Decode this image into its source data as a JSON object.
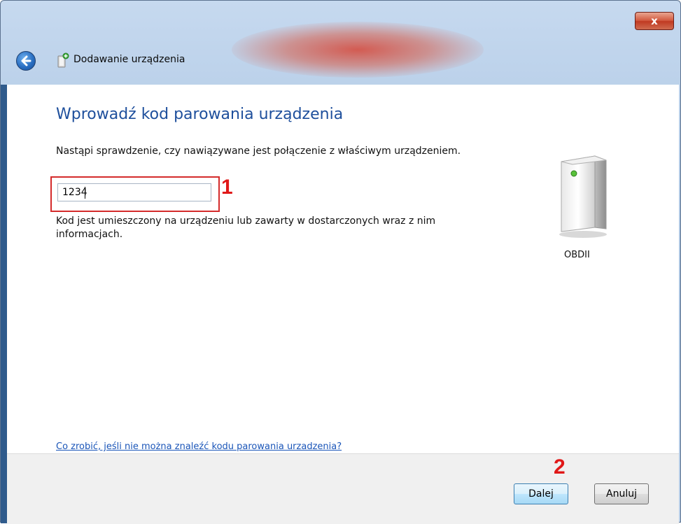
{
  "window": {
    "title": "Dodawanie urządzenia",
    "close_glyph": "x"
  },
  "content": {
    "heading": "Wprowadź kod parowania urządzenia",
    "instruction": "Nastąpi sprawdzenie, czy nawiązywane jest połączenie z właściwym urządzeniem.",
    "code_value": "1234",
    "hint": "Kod jest umieszczony na urządzeniu lub zawarty w dostarczonych wraz z nim informacjach.",
    "help_link": "Co zrobić, jeśli nie można znaleźć kodu parowania urzadzenia?"
  },
  "device": {
    "name": "OBDII",
    "icon": "device-tower-icon"
  },
  "annotations": {
    "marker_1": "1",
    "marker_2": "2"
  },
  "buttons": {
    "next": "Dalej",
    "cancel": "Anuluj"
  },
  "colors": {
    "heading": "#1e4f9c",
    "link": "#1a55b8",
    "marker": "#e01818"
  }
}
